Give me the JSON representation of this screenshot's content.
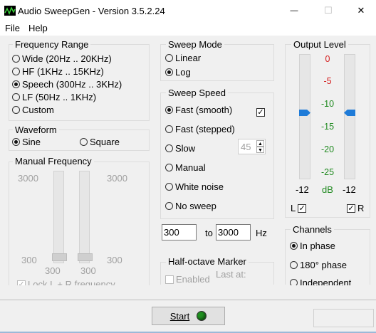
{
  "window": {
    "title": "Audio SweepGen - Version 3.5.2.24",
    "minimize": "—",
    "maximize": "☐",
    "close": "✕"
  },
  "menu": {
    "file": "File",
    "help": "Help"
  },
  "frequency_range": {
    "label": "Frequency Range",
    "options": [
      {
        "label": "Wide  (20Hz .. 20KHz)",
        "selected": false
      },
      {
        "label": "HF  (1KHz .. 15KHz)",
        "selected": false
      },
      {
        "label": "Speech  (300Hz .. 3KHz)",
        "selected": true
      },
      {
        "label": "LF  (50Hz .. 1KHz)",
        "selected": false
      },
      {
        "label": "Custom",
        "selected": false
      }
    ]
  },
  "waveform": {
    "label": "Waveform",
    "sine": "Sine",
    "square": "Square",
    "selected": "sine"
  },
  "manual_frequency": {
    "label": "Manual Frequency",
    "left_max": "3000",
    "right_max": "3000",
    "left_min": "300",
    "right_min": "300",
    "under_left": "300",
    "under_right": "300",
    "lock_label": "Lock L + R frequency",
    "lock_checked": true
  },
  "sweep_mode": {
    "label": "Sweep Mode",
    "linear": "Linear",
    "log": "Log",
    "selected": "log"
  },
  "sweep_speed": {
    "label": "Sweep Speed",
    "options": [
      {
        "label": "Fast (smooth)",
        "selected": true
      },
      {
        "label": "Fast (stepped)",
        "selected": false
      },
      {
        "label": "Slow",
        "selected": false
      },
      {
        "label": "Manual",
        "selected": false
      },
      {
        "label": "White noise",
        "selected": false
      },
      {
        "label": "No sweep",
        "selected": false
      }
    ],
    "smooth_checked": true,
    "slow_value": "45"
  },
  "range": {
    "from": "300",
    "to_label": "to",
    "to": "3000",
    "unit": "Hz"
  },
  "half_octave": {
    "label": "Half-octave Marker",
    "enabled_label": "Enabled",
    "enabled_checked": false,
    "last_at_label": "Last at:"
  },
  "output_level": {
    "label": "Output Level",
    "scale": [
      "0",
      "-5",
      "-10",
      "-15",
      "-20",
      "-25"
    ],
    "left_value": "-12",
    "unit": "dB",
    "right_value": "-12",
    "left_label": "L",
    "right_label": "R",
    "left_checked": true,
    "right_checked": true,
    "colors": {
      "red": "#d42020",
      "green": "#208a20",
      "thumb": "#1e7bd8"
    }
  },
  "channels": {
    "label": "Channels",
    "options": [
      {
        "label": "In phase",
        "selected": true
      },
      {
        "label": "180° phase",
        "selected": false
      },
      {
        "label": "Independent",
        "selected": false
      }
    ]
  },
  "start_button": {
    "label": "Start",
    "led_color": "#1f8f1f"
  }
}
